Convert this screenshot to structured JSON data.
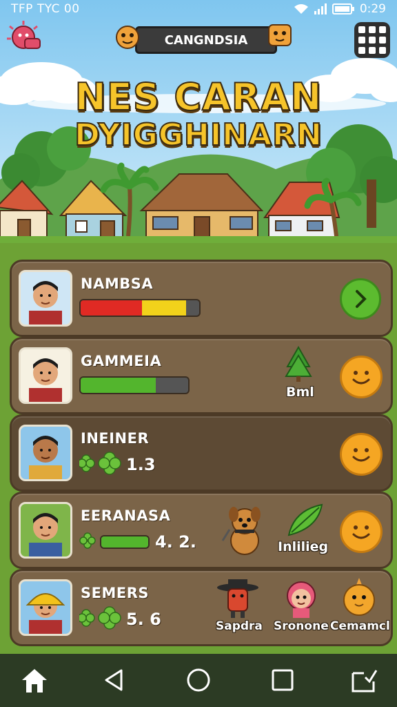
{
  "status_bar": {
    "left_text": "TFP TYC 00",
    "time": "0:29"
  },
  "header": {
    "banner_title": "CANGNDSIA"
  },
  "title": {
    "line1": "NES CARAN",
    "line2": "DYIGGHINARN"
  },
  "players": [
    {
      "name": "NAMBSA",
      "bar": {
        "red": 0.52,
        "yellow": 0.37
      }
    },
    {
      "name": "GAMMEIA",
      "bar": {
        "green": 0.7
      },
      "item_label": "Bml"
    },
    {
      "name": "INEINER",
      "value": "1.3"
    },
    {
      "name": "EERANASA",
      "value": "4. 2.",
      "bar": {
        "green": 1.0
      },
      "item_label": "Inlilieg"
    },
    {
      "name": "SEMERS",
      "value": "5. 6",
      "characters": [
        "Sapdra",
        "Sronone",
        "Cemamcl"
      ]
    }
  ],
  "colors": {
    "accent": "#f6c42a",
    "card": "#7b6448",
    "go": "#5cbb2f",
    "smiley": "#f5a623"
  },
  "icons": [
    "menu-grid-icon",
    "home-icon",
    "back-icon",
    "circle-home-icon",
    "recents-icon",
    "share-icon"
  ]
}
